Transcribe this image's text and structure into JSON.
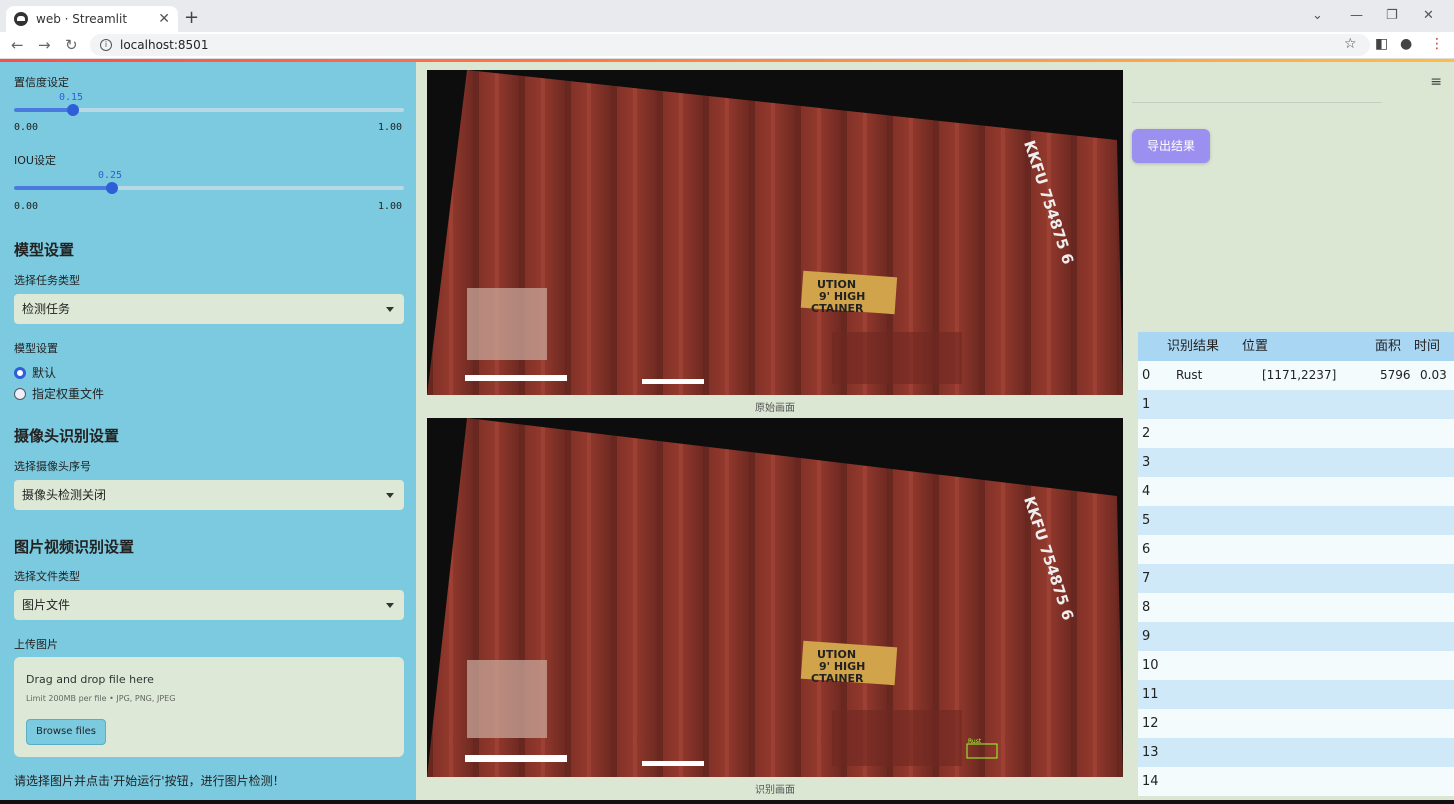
{
  "browser": {
    "tab_title": "web · Streamlit",
    "tab_close": "✕",
    "new_tab": "+",
    "minimize": "⌄",
    "min2": "—",
    "restore": "❐",
    "close": "✕",
    "url": "localhost:8501",
    "back": "←",
    "forward": "→",
    "reload": "↻",
    "star": "☆",
    "sidepanel": "◧",
    "profile": "●",
    "menu": "⋮"
  },
  "sidebar": {
    "conf_label": "置信度设定",
    "conf_value": "0.15",
    "conf_min": "0.00",
    "conf_max": "1.00",
    "conf_fraction": 0.15,
    "iou_label": "IOU设定",
    "iou_value": "0.25",
    "iou_min": "0.00",
    "iou_max": "1.00",
    "iou_fraction": 0.25,
    "model_heading": "模型设置",
    "task_label": "选择任务类型",
    "task_value": "检测任务",
    "model_label": "模型设置",
    "radio_default": "默认",
    "radio_custom": "指定权重文件",
    "camera_heading": "摄像头识别设置",
    "camera_label": "选择摄像头序号",
    "camera_value": "摄像头检测关闭",
    "media_heading": "图片视频识别设置",
    "filetype_label": "选择文件类型",
    "filetype_value": "图片文件",
    "upload_label": "上传图片",
    "drop_text": "Drag and drop file here",
    "limit_text": "Limit 200MB per file • JPG, PNG, JPEG",
    "browse_label": "Browse files",
    "hint": "请选择图片并点击'开始运行'按钮，进行图片检测！"
  },
  "main": {
    "caption_original": "原始画面",
    "caption_result": "识别画面",
    "export_label": "导出结果",
    "hamburger": "≡",
    "container_text": "KKFU 754875 6",
    "sticker_lines": [
      "UTION",
      "9' HIGH",
      "CTAINER"
    ],
    "detection_label": "Rust"
  },
  "table": {
    "headers": [
      "",
      "识别结果",
      "位置",
      "面积",
      "时间"
    ],
    "rows": [
      {
        "idx": "0",
        "result": "Rust",
        "pos": "[1171,2237]",
        "area": "5796",
        "time": "0.03"
      },
      {
        "idx": "1",
        "result": "",
        "pos": "",
        "area": "",
        "time": ""
      },
      {
        "idx": "2",
        "result": "",
        "pos": "",
        "area": "",
        "time": ""
      },
      {
        "idx": "3",
        "result": "",
        "pos": "",
        "area": "",
        "time": ""
      },
      {
        "idx": "4",
        "result": "",
        "pos": "",
        "area": "",
        "time": ""
      },
      {
        "idx": "5",
        "result": "",
        "pos": "",
        "area": "",
        "time": ""
      },
      {
        "idx": "6",
        "result": "",
        "pos": "",
        "area": "",
        "time": ""
      },
      {
        "idx": "7",
        "result": "",
        "pos": "",
        "area": "",
        "time": ""
      },
      {
        "idx": "8",
        "result": "",
        "pos": "",
        "area": "",
        "time": ""
      },
      {
        "idx": "9",
        "result": "",
        "pos": "",
        "area": "",
        "time": ""
      },
      {
        "idx": "10",
        "result": "",
        "pos": "",
        "area": "",
        "time": ""
      },
      {
        "idx": "11",
        "result": "",
        "pos": "",
        "area": "",
        "time": ""
      },
      {
        "idx": "12",
        "result": "",
        "pos": "",
        "area": "",
        "time": ""
      },
      {
        "idx": "13",
        "result": "",
        "pos": "",
        "area": "",
        "time": ""
      },
      {
        "idx": "14",
        "result": "",
        "pos": "",
        "area": "",
        "time": ""
      }
    ]
  },
  "colors": {
    "sidebar_bg": "#7ccadf",
    "main_bg": "#dce7d3",
    "accent_blue": "#2f5fd8",
    "export_button": "#9b8ff0",
    "container_red": "#8a3327"
  }
}
